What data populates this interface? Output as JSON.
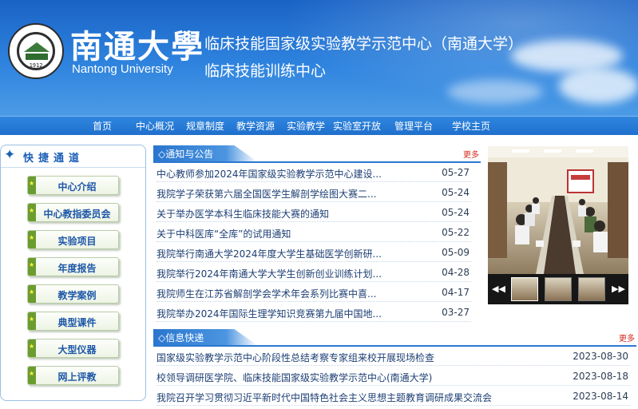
{
  "header": {
    "logo_cn": "南通大學",
    "logo_en": "Nantong University",
    "emblem_year": "1912",
    "title_line1": "临床技能国家级实验教学示范中心（南通大学）",
    "title_line2": "临床技能训练中心"
  },
  "nav": {
    "items": [
      "首页",
      "中心概况",
      "规章制度",
      "教学资源",
      "实验教学",
      "实验室开放",
      "管理平台",
      "学校主页"
    ]
  },
  "sidebar": {
    "title": "快捷通道",
    "items": [
      "中心介绍",
      "中心教指委员会",
      "实验项目",
      "年度报告",
      "教学案例",
      "典型课件",
      "大型仪器",
      "网上评教"
    ]
  },
  "notices": {
    "title": "◇通知与公告",
    "more": "更多",
    "items": [
      {
        "title": "中心教师参加2024年国家级实验教学示范中心建设...",
        "date": "05-27"
      },
      {
        "title": "我院学子荣获第六届全国医学生解剖学绘图大赛二...",
        "date": "05-24"
      },
      {
        "title": "关于举办医学本科生临床技能大赛的通知",
        "date": "05-24"
      },
      {
        "title": "关于中科医库“全库”的试用通知",
        "date": "05-22"
      },
      {
        "title": "我院举行南通大学2024年度大学生基础医学创新研...",
        "date": "05-09"
      },
      {
        "title": "我院举行2024年南通大学大学生创新创业训练计划...",
        "date": "04-28"
      },
      {
        "title": "我院师生在江苏省解剖学会学术年会系列比赛中喜...",
        "date": "04-17"
      },
      {
        "title": "我院举办2024年国际生理学知识竞赛第九届中国地...",
        "date": "03-27"
      }
    ]
  },
  "news": {
    "title": "◇信息快递",
    "more": "更多",
    "items": [
      {
        "title": "国家级实验教学示范中心阶段性总结考察专家组来校开展现场检查",
        "date": "2023-08-30"
      },
      {
        "title": "校领导调研医学院、临床技能国家级实验教学示范中心(南通大学)",
        "date": "2023-08-18"
      },
      {
        "title": "我院召开学习贯彻习近平新时代中国特色社会主义思想主题教育调研成果交流会",
        "date": "2023-08-14"
      }
    ]
  },
  "slideshow": {
    "prev_icon": "◀◀",
    "next_icon": "▶▶"
  },
  "colors": {
    "header_blue": "#2e83de",
    "nav_blue": "#1f6fcc",
    "more_red": "#d42a1e",
    "button_green": "#6b9c2f"
  }
}
